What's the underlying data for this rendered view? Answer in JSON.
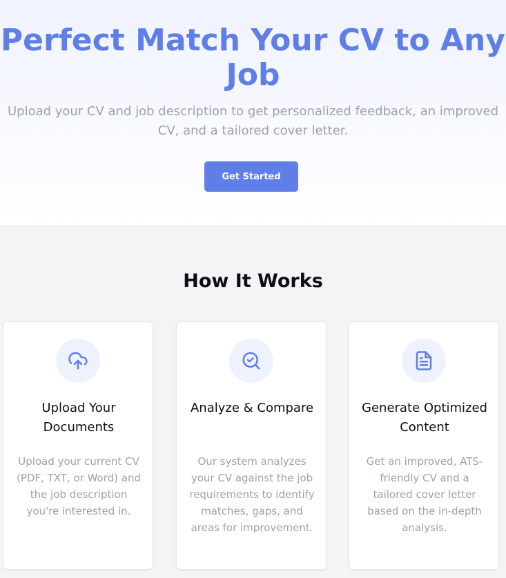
{
  "hero": {
    "title": "Perfect Match Your CV to Any Job",
    "subtitle": "Upload your CV and job description to get personalized feedback, an improved CV, and a tailored cover letter.",
    "cta_label": "Get Started"
  },
  "how_it_works": {
    "title": "How It Works",
    "steps": [
      {
        "icon": "cloud-upload-icon",
        "title": "Upload Your Documents",
        "description": "Upload your current CV (PDF, TXT, or Word) and the job description you're interested in."
      },
      {
        "icon": "search-check-icon",
        "title": "Analyze & Compare",
        "description": "Our system analyzes your CV against the job requirements to identify matches, gaps, and areas for improvement."
      },
      {
        "icon": "document-icon",
        "title": "Generate Optimized Content",
        "description": "Get an improved, ATS-friendly CV and a tailored cover letter based on the in-depth analysis."
      }
    ]
  },
  "colors": {
    "accent": "#5f7ee8",
    "heading": "#0d0f14",
    "muted_text": "#9aa1b0",
    "icon_bg": "#eef2fd",
    "section_bg": "#f3f4f6"
  }
}
